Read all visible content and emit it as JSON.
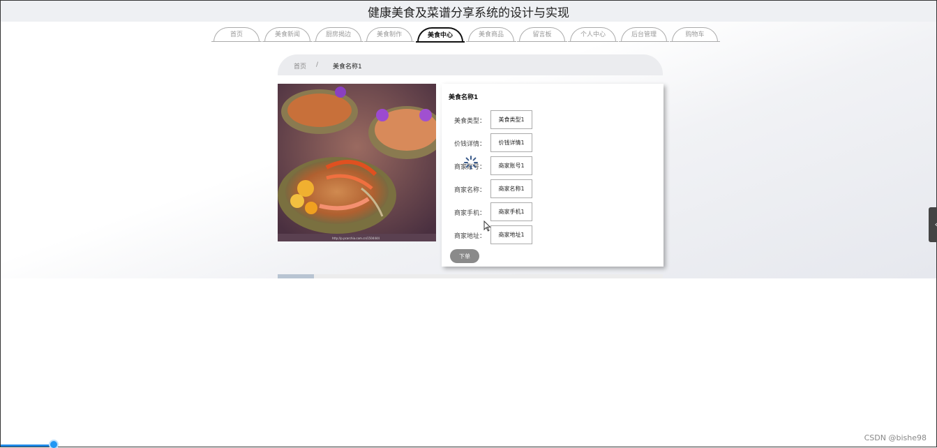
{
  "header": {
    "title": "健康美食及菜谱分享系统的设计与实现"
  },
  "nav": {
    "tabs": [
      {
        "label": "首页",
        "active": false
      },
      {
        "label": "美食新闻",
        "active": false
      },
      {
        "label": "厨房揭边",
        "active": false
      },
      {
        "label": "美食制作",
        "active": false
      },
      {
        "label": "美食中心",
        "active": true
      },
      {
        "label": "美食商品",
        "active": false
      },
      {
        "label": "留言板",
        "active": false
      },
      {
        "label": "个人中心",
        "active": false
      },
      {
        "label": "后台管理",
        "active": false
      },
      {
        "label": "购物车",
        "active": false
      }
    ]
  },
  "breadcrumb": {
    "home": "首页",
    "separator": "/",
    "current": "美食名称1"
  },
  "detail": {
    "name": "美食名称1",
    "fields": [
      {
        "label": "美食类型：",
        "value": "美食类型1"
      },
      {
        "label": "价钱详情：",
        "value": "价钱详情1"
      },
      {
        "label": "商家账号：",
        "value": "商家账号1"
      },
      {
        "label": "商家名称：",
        "value": "商家名称1"
      },
      {
        "label": "商家手机：",
        "value": "商家手机1"
      },
      {
        "label": "商家地址：",
        "value": "商家地址1"
      }
    ],
    "order_label": "下单"
  },
  "image": {
    "caption": "http://p.pcarchia.com.cn/1504444"
  },
  "side_handle": {
    "icon": "chevron-left-icon",
    "glyph": "‹"
  },
  "watermark": "CSDN @bishe98",
  "colors": {
    "accent": "#1e88e5",
    "order_button": "#8a8a8a"
  }
}
